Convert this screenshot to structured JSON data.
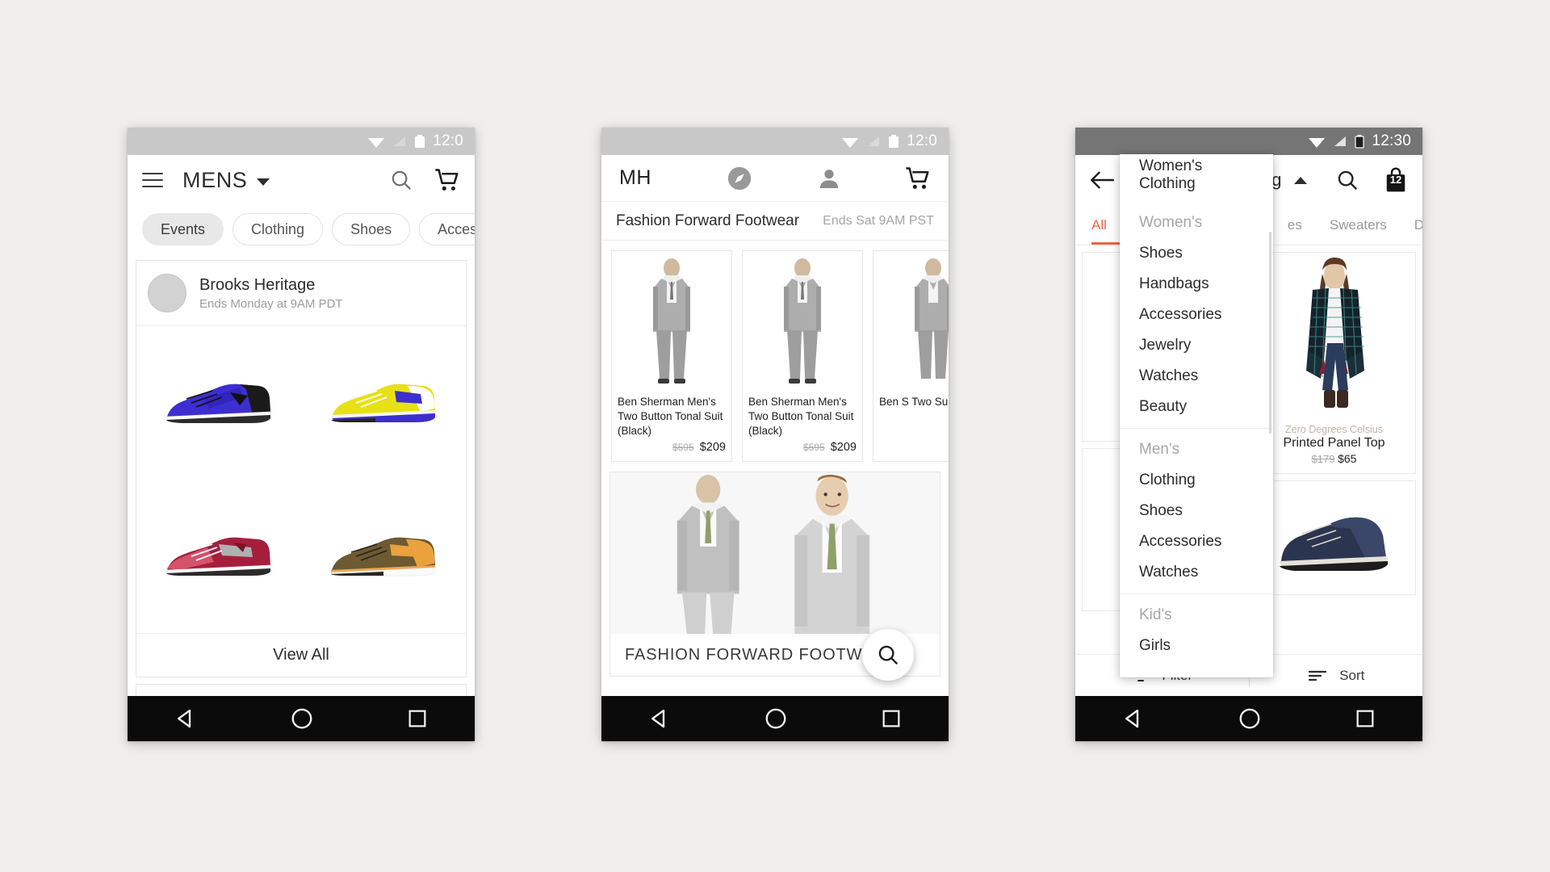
{
  "phone1": {
    "status": {
      "time": "12:0",
      "icons": [
        "wifi-icon",
        "signal-icon",
        "battery-icon"
      ]
    },
    "appbar": {
      "menu_icon": "hamburger-icon",
      "title": "MENS",
      "dropdown_icon": "caret-down-icon",
      "search_icon": "search-icon",
      "cart_icon": "cart-icon"
    },
    "chips": [
      {
        "label": "Events",
        "active": true
      },
      {
        "label": "Clothing",
        "active": false
      },
      {
        "label": "Shoes",
        "active": false
      },
      {
        "label": "Acces",
        "active": false
      }
    ],
    "event": {
      "name": "Brooks Heritage",
      "ends": "Ends Monday at 9AM PDT",
      "view_all": "View All",
      "products": [
        "blue-sneaker",
        "yellow-sneaker",
        "red-sneaker",
        "brown-sneaker"
      ]
    }
  },
  "phone2": {
    "status": {
      "time": "12:0"
    },
    "appbar": {
      "logo": "MH",
      "explore_icon": "compass-icon",
      "account_icon": "person-icon",
      "cart_icon": "cart-icon"
    },
    "sale": {
      "title": "Fashion Forward Footwear",
      "ends": "Ends Sat 9AM PST"
    },
    "products": [
      {
        "name": "Ben Sherman Men's Two Button Tonal Suit (Black)",
        "price_old": "$595",
        "price_new": "$209"
      },
      {
        "name": "Ben Sherman Men's Two Button Tonal Suit (Black)",
        "price_old": "$595",
        "price_new": "$209"
      },
      {
        "name": "Ben S Two Suit (",
        "price_old": "",
        "price_new": ""
      }
    ],
    "hero": {
      "caption": "FASHION FORWARD FOOTWEAR",
      "fab_icon": "search-icon"
    }
  },
  "phone3": {
    "status": {
      "time": "12:30"
    },
    "appbar": {
      "back_icon": "arrow-back-icon",
      "title": "Women's Clothing",
      "dropdown_icon": "caret-up-icon",
      "search_icon": "search-icon",
      "bag_icon": "shopping-bag-icon",
      "bag_count": "12"
    },
    "tabs": [
      {
        "label": "All",
        "active": true
      },
      {
        "label": "es",
        "active": false
      },
      {
        "label": "Sweaters",
        "active": false
      },
      {
        "label": "Denim",
        "active": false
      }
    ],
    "menu": {
      "selected": "Women's Clothing",
      "groups": [
        {
          "header": "Women's",
          "items": [
            "Shoes",
            "Handbags",
            "Accessories",
            "Jewelry",
            "Watches",
            "Beauty"
          ]
        },
        {
          "header": "Men's",
          "items": [
            "Clothing",
            "Shoes",
            "Accessories",
            "Watches"
          ]
        },
        {
          "header": "Kid's",
          "items": [
            "Girls"
          ]
        }
      ]
    },
    "products": [
      {
        "brand": "Zero Degrees Celsius",
        "name": "Printed Panel Top",
        "price_old": "$179",
        "price_new": "$65"
      }
    ],
    "bottom": {
      "filter_label": "Filter",
      "filter_icon": "filter-icon",
      "sort_label": "Sort",
      "sort_icon": "sort-icon"
    }
  },
  "theme": {
    "background": "#f0efed",
    "accent": "#f2643f",
    "statusbar_light": "#c8c8c8",
    "statusbar_dark": "#757575",
    "navbar": "#0b0b0b"
  }
}
